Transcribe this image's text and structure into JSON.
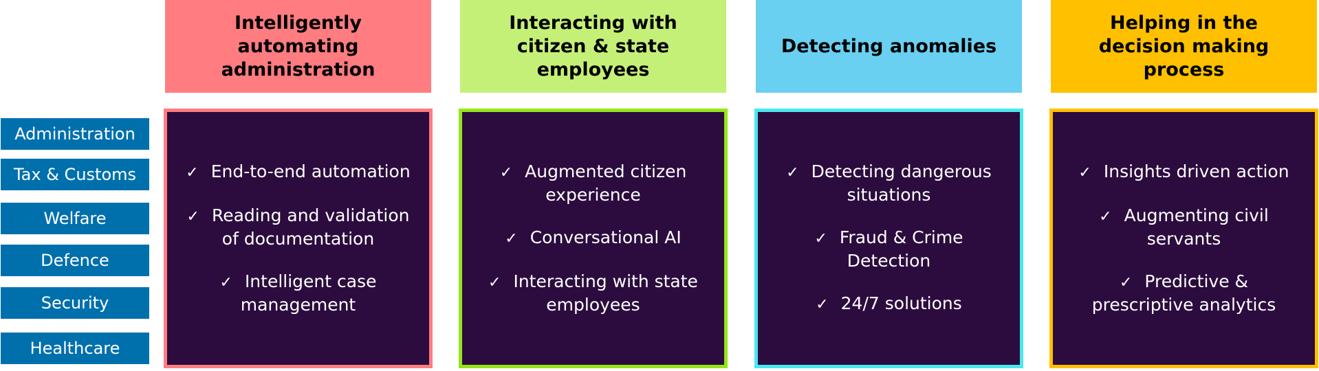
{
  "sectors": [
    "Administration",
    "Tax & Customs",
    "Welfare",
    "Defence",
    "Security",
    "Healthcare"
  ],
  "columns": [
    {
      "title": "Intelligently\nautomating\nadministration",
      "header_color": "#ff7c80",
      "border_color": "#ff7c80",
      "items": [
        "End-to-end automation",
        "Reading and validation\nof documentation",
        "Intelligent case\nmanagement"
      ]
    },
    {
      "title": "Interacting with\ncitizen & state\nemployees",
      "header_color": "#c5f077",
      "border_color": "#95e616",
      "items": [
        "Augmented citizen\nexperience",
        "Conversational AI",
        "Interacting with state\nemployees"
      ]
    },
    {
      "title": "Detecting anomalies",
      "header_color": "#69d0f2",
      "border_color": "#4ae8ef",
      "items": [
        "Detecting dangerous\nsituations",
        "Fraud & Crime\nDetection",
        "24/7 solutions"
      ]
    },
    {
      "title": "Helping in the\ndecision making\nprocess",
      "header_color": "#ffc000",
      "border_color": "#ffc000",
      "items": [
        "Insights driven action",
        "Augmenting civil\nservants",
        "Predictive &\nprescriptive analytics"
      ]
    }
  ],
  "check_glyph": "✓"
}
